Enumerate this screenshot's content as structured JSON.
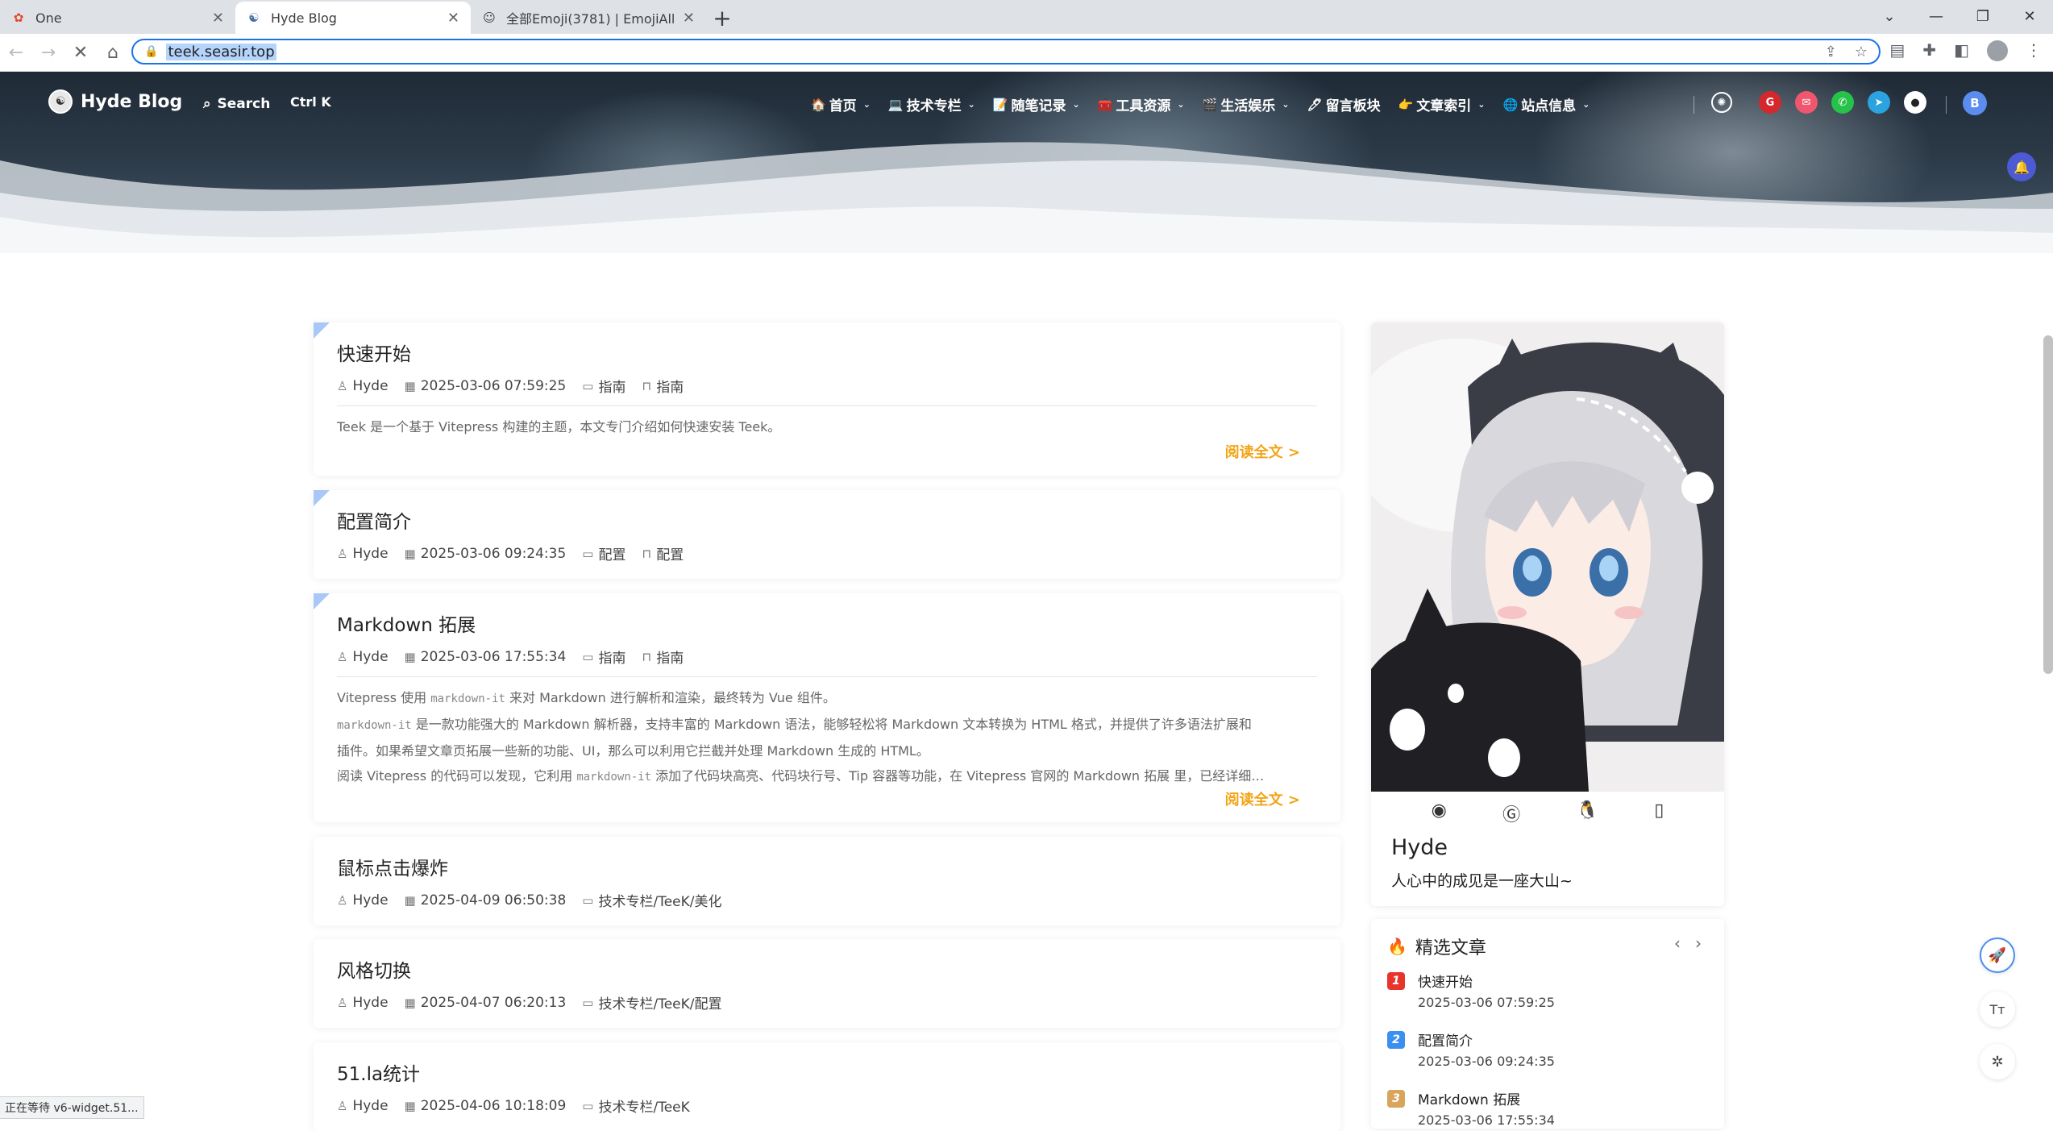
{
  "browser": {
    "tabs": [
      {
        "title": "One",
        "icon": "one-favicon"
      },
      {
        "title": "Hyde Blog",
        "icon": "hyde-favicon"
      },
      {
        "title": "全部Emoji(3781) | EmojiAll",
        "icon": "emojiall-favicon"
      }
    ],
    "url": "teek.seasir.top",
    "status": "正在等待 v6-widget.51..."
  },
  "site": {
    "brand": "Hyde Blog",
    "search_label": "Search",
    "search_shortcut": "Ctrl K",
    "menu": [
      {
        "icon": "🏠",
        "label": "首页"
      },
      {
        "icon": "💻",
        "label": "技术专栏"
      },
      {
        "icon": "📝",
        "label": "随笔记录"
      },
      {
        "icon": "🧰",
        "label": "工具资源"
      },
      {
        "icon": "🎬",
        "label": "生活娱乐"
      },
      {
        "icon": "🖊",
        "label": "留言板块"
      },
      {
        "icon": "👉",
        "label": "文章索引"
      },
      {
        "icon": "🌐",
        "label": "站点信息"
      }
    ],
    "user_initial": "B",
    "colors": {
      "accent": "#f2a417",
      "nav_text": "#ffffff",
      "avatar": "#5b8def"
    }
  },
  "posts": [
    {
      "title": "快速开始",
      "author": "Hyde",
      "date": "2025-03-06 07:59:25",
      "category": "指南",
      "tag": "指南",
      "excerpt": "Teek 是一个基于 Vitepress 构建的主题，本文专门介绍如何快速安装 Teek。",
      "more": "阅读全文 >"
    },
    {
      "title": "配置简介",
      "author": "Hyde",
      "date": "2025-03-06 09:24:35",
      "category": "配置",
      "tag": "配置"
    },
    {
      "title": "Markdown 拓展",
      "author": "Hyde",
      "date": "2025-03-06 17:55:34",
      "category": "指南",
      "tag": "指南",
      "excerpt_lines": [
        {
          "a": "Vitepress 使用 ",
          "code": "markdown-it",
          "b": " 来对 Markdown 进行解析和渲染，最终转为 Vue 组件。"
        },
        {
          "a": "",
          "code": "markdown-it",
          "b": " 是一款功能强大的 Markdown 解析器，支持丰富的 Markdown 语法，能够轻松将 Markdown 文本转换为 HTML 格式，并提供了许多语法扩展和"
        },
        {
          "a": "插件。如果希望文章页拓展一些新的功能、UI，那么可以利用它拦截并处理 Markdown 生成的 HTML。",
          "code": "",
          "b": ""
        },
        {
          "a": "阅读 Vitepress 的代码可以发现，它利用 ",
          "code": "markdown-it",
          "b": " 添加了代码块高亮、代码块行号、Tip 容器等功能，在 Vitepress 官网的 Markdown 拓展 里，已经详细…"
        }
      ],
      "more": "阅读全文 >"
    },
    {
      "title": "鼠标点击爆炸",
      "author": "Hyde",
      "date": "2025-04-09 06:50:38",
      "category": "技术专栏/TeeK/美化"
    },
    {
      "title": "风格切换",
      "author": "Hyde",
      "date": "2025-04-07 06:20:13",
      "category": "技术专栏/TeeK/配置"
    },
    {
      "title": "51.la统计",
      "author": "Hyde",
      "date": "2025-04-06 10:18:09",
      "category": "技术专栏/TeeK"
    }
  ],
  "profile": {
    "name": "Hyde",
    "motto": "人心中的成见是一座大山~",
    "links": [
      "github-icon",
      "gitee-icon",
      "qq-icon",
      "phone-icon"
    ]
  },
  "featured": {
    "title": "精选文章",
    "items": [
      {
        "rank": "1",
        "title": "快速开始",
        "date": "2025-03-06 07:59:25",
        "color": "#e8352c"
      },
      {
        "rank": "2",
        "title": "配置简介",
        "date": "2025-03-06 09:24:35",
        "color": "#3b8ff0"
      },
      {
        "rank": "3",
        "title": "Markdown 拓展",
        "date": "2025-03-06 17:55:34",
        "color": "#d9a45b"
      }
    ]
  },
  "tools": {
    "font_label": "Tт"
  }
}
